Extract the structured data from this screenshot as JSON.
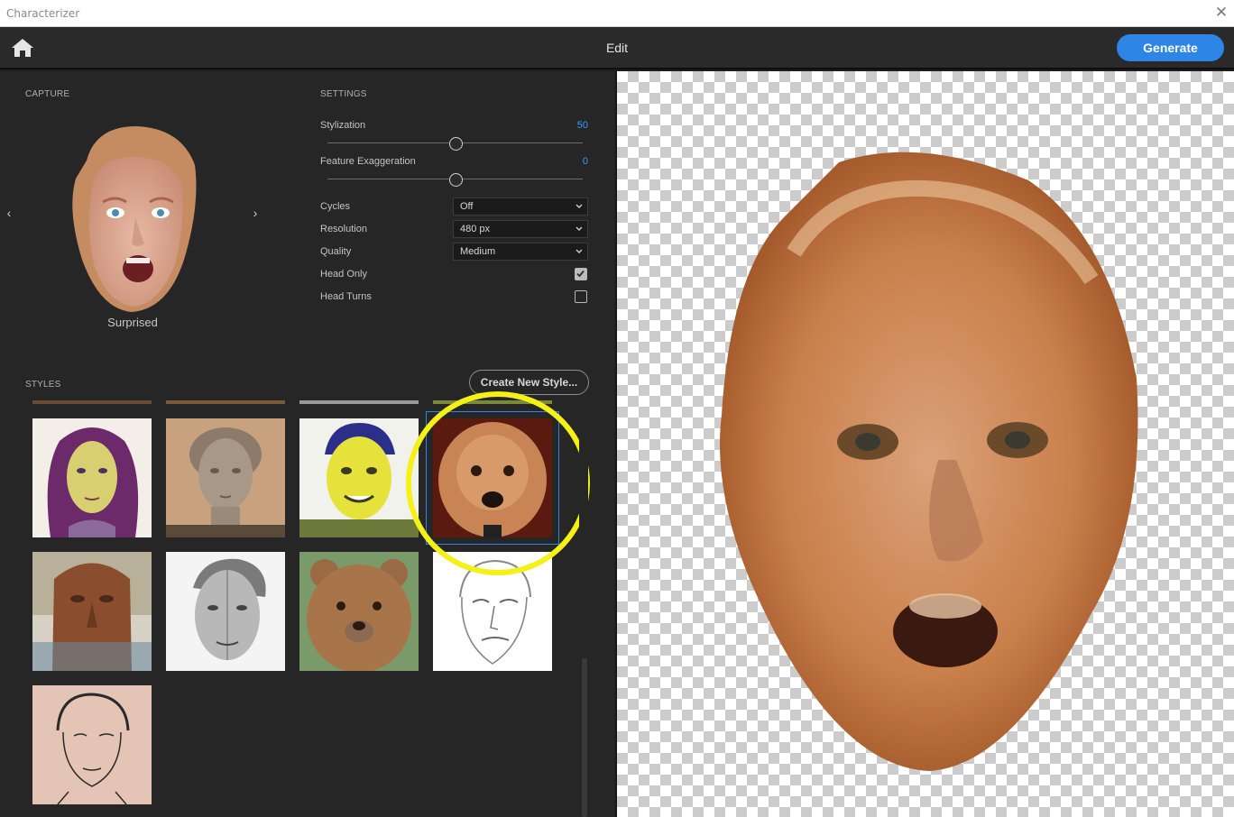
{
  "window": {
    "title": "Characterizer",
    "close_glyph": "✕"
  },
  "topbar": {
    "home_icon": "home-icon",
    "title": "Edit",
    "generate_label": "Generate"
  },
  "capture": {
    "label": "CAPTURE",
    "caption": "Surprised",
    "prev_glyph": "‹",
    "next_glyph": "›"
  },
  "settings": {
    "label": "SETTINGS",
    "stylization": {
      "label": "Stylization",
      "value": "50",
      "fraction": 0.5
    },
    "exaggeration": {
      "label": "Feature Exaggeration",
      "value": "0",
      "fraction": 0.5
    },
    "cycles": {
      "label": "Cycles",
      "value": "Off"
    },
    "resolution": {
      "label": "Resolution",
      "value": "480 px"
    },
    "quality": {
      "label": "Quality",
      "value": "Medium"
    },
    "head_only": {
      "label": "Head Only",
      "checked": true
    },
    "head_turns": {
      "label": "Head Turns",
      "checked": false
    }
  },
  "styles": {
    "label": "STYLES",
    "create_label": "Create New Style...",
    "selected_index": 3,
    "accent": "#2d85e6",
    "highlight": "#f5f018"
  }
}
